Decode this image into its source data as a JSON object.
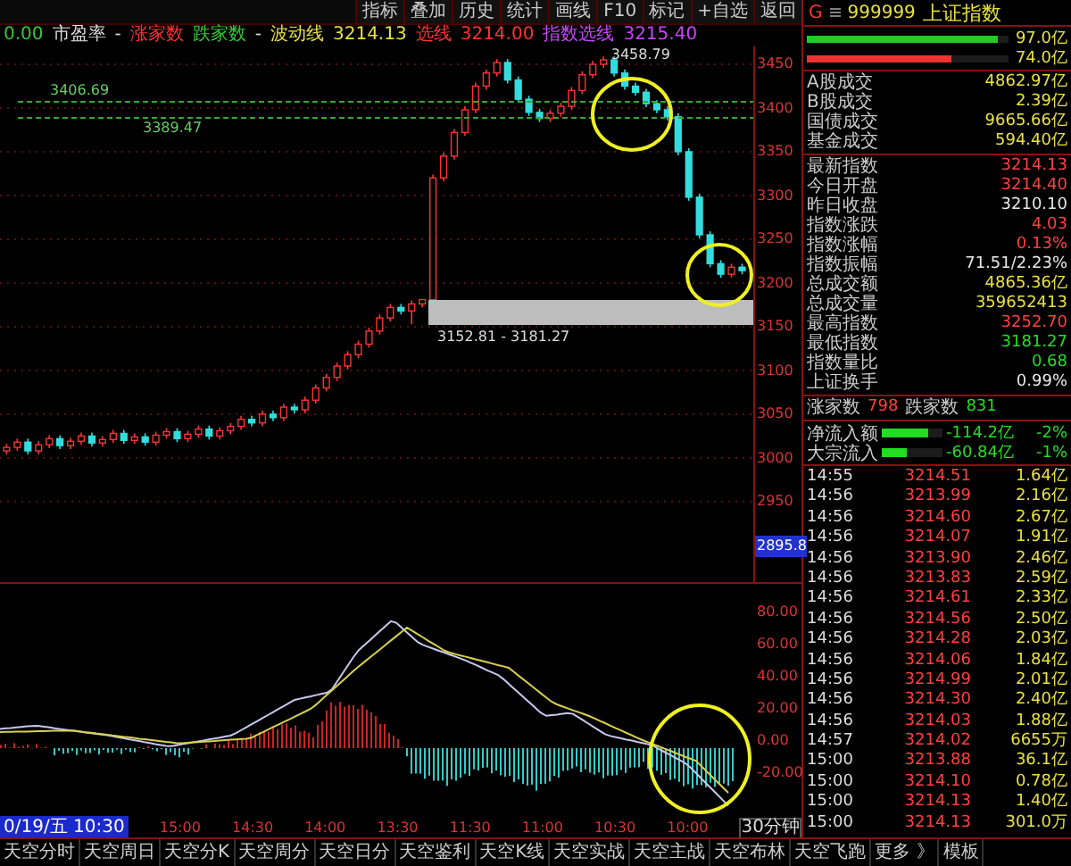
{
  "toolbar": {
    "buttons": [
      "指标",
      "叠加",
      "历史",
      "统计",
      "画线",
      "F10",
      "标记",
      "+自选",
      "返回"
    ]
  },
  "info_bar": [
    {
      "text": "0.00",
      "color": "#33cc33"
    },
    {
      "text": "市盈率",
      "color": "#dddddd"
    },
    {
      "text": "-",
      "color": "#dddddd"
    },
    {
      "text": "涨家数",
      "color": "#ff3333"
    },
    {
      "text": "跌家数",
      "color": "#33cc33"
    },
    {
      "text": "-",
      "color": "#dddddd"
    },
    {
      "text": "波动线",
      "color": "#e8e040"
    },
    {
      "text": "3214.13",
      "color": "#e8e040"
    },
    {
      "text": "选线",
      "color": "#ff3333"
    },
    {
      "text": "3214.00",
      "color": "#ff3333"
    },
    {
      "text": "指数选线",
      "color": "#cc44ff"
    },
    {
      "text": "3215.40",
      "color": "#cc44ff"
    }
  ],
  "price_chart": {
    "level_labels": [
      "3406.69",
      "3389.47"
    ],
    "range_label": "3152.81 - 3181.27",
    "current_label": "2895.8",
    "chart_data": {
      "type": "candlestick",
      "grid": true,
      "ylim": [
        2858,
        3470.4
      ],
      "yticks": [
        3450,
        3400,
        3350,
        3300,
        3250,
        3200,
        3150,
        3100,
        3050,
        3000,
        2950
      ],
      "annotations": [
        "3458.79"
      ],
      "ohlc": [
        [
          3008,
          3016,
          3004,
          3012
        ],
        [
          3012,
          3022,
          3008,
          3018
        ],
        [
          3018,
          3022,
          3004,
          3008
        ],
        [
          3008,
          3019,
          3004,
          3015
        ],
        [
          3015,
          3026,
          3011,
          3022
        ],
        [
          3022,
          3026,
          3010,
          3014
        ],
        [
          3014,
          3023,
          3010,
          3019
        ],
        [
          3019,
          3029,
          3015,
          3025
        ],
        [
          3025,
          3029,
          3013,
          3017
        ],
        [
          3017,
          3025,
          3013,
          3021
        ],
        [
          3021,
          3032,
          3017,
          3028
        ],
        [
          3028,
          3032,
          3016,
          3020
        ],
        [
          3020,
          3028,
          3016,
          3024
        ],
        [
          3024,
          3028,
          3014,
          3018
        ],
        [
          3018,
          3030,
          3014,
          3026
        ],
        [
          3026,
          3034,
          3022,
          3030
        ],
        [
          3030,
          3034,
          3018,
          3022
        ],
        [
          3022,
          3031,
          3018,
          3027
        ],
        [
          3027,
          3037,
          3023,
          3033
        ],
        [
          3033,
          3037,
          3021,
          3025
        ],
        [
          3025,
          3035,
          3021,
          3031
        ],
        [
          3031,
          3040,
          3027,
          3036
        ],
        [
          3036,
          3048,
          3032,
          3044
        ],
        [
          3044,
          3048,
          3036,
          3040
        ],
        [
          3040,
          3054,
          3036,
          3050
        ],
        [
          3050,
          3054,
          3042,
          3046
        ],
        [
          3046,
          3062,
          3042,
          3058
        ],
        [
          3058,
          3062,
          3051,
          3055
        ],
        [
          3055,
          3070,
          3051,
          3066
        ],
        [
          3066,
          3084,
          3062,
          3080
        ],
        [
          3080,
          3096,
          3076,
          3092
        ],
        [
          3092,
          3109,
          3088,
          3105
        ],
        [
          3105,
          3122,
          3101,
          3118
        ],
        [
          3118,
          3134,
          3114,
          3130
        ],
        [
          3130,
          3149,
          3126,
          3145
        ],
        [
          3145,
          3164,
          3141,
          3160
        ],
        [
          3160,
          3176,
          3156,
          3172
        ],
        [
          3172,
          3176,
          3164,
          3168
        ],
        [
          3168,
          3180,
          3152.81,
          3176
        ],
        [
          3176,
          3181.27,
          3172,
          3181
        ],
        [
          3181,
          3324,
          3177,
          3320
        ],
        [
          3320,
          3349,
          3316,
          3345
        ],
        [
          3345,
          3376,
          3341,
          3372
        ],
        [
          3372,
          3402,
          3368,
          3398
        ],
        [
          3398,
          3429,
          3394,
          3425
        ],
        [
          3425,
          3444,
          3421,
          3440
        ],
        [
          3440,
          3456,
          3436,
          3452
        ],
        [
          3452,
          3456,
          3428,
          3432
        ],
        [
          3432,
          3436,
          3406,
          3410
        ],
        [
          3410,
          3414,
          3391,
          3395
        ],
        [
          3395,
          3399,
          3384,
          3388
        ],
        [
          3388,
          3398,
          3384,
          3394
        ],
        [
          3394,
          3406,
          3390,
          3402
        ],
        [
          3402,
          3424,
          3398,
          3420
        ],
        [
          3420,
          3442,
          3416,
          3438
        ],
        [
          3438,
          3454,
          3434,
          3450
        ],
        [
          3450,
          3458.79,
          3446,
          3455
        ],
        [
          3455,
          3459,
          3436,
          3440
        ],
        [
          3440,
          3444,
          3421,
          3425
        ],
        [
          3425,
          3429,
          3414,
          3418
        ],
        [
          3418,
          3422,
          3401,
          3405
        ],
        [
          3405,
          3409,
          3394,
          3398
        ],
        [
          3398,
          3402,
          3386,
          3390
        ],
        [
          3390,
          3394,
          3346,
          3350
        ],
        [
          3350,
          3354,
          3294,
          3298
        ],
        [
          3298,
          3302,
          3251,
          3255
        ],
        [
          3255,
          3259,
          3218,
          3222
        ],
        [
          3222,
          3226,
          3206,
          3210
        ],
        [
          3210,
          3222,
          3206,
          3218
        ],
        [
          3218,
          3222,
          3210,
          3214
        ]
      ]
    }
  },
  "macd_chart": {
    "y_axis": [
      "80.00",
      "60.00",
      "40.00",
      "20.00",
      "0.00",
      "-20.00"
    ]
  },
  "time_axis": {
    "labels": [
      "0/19/五 10:30",
      "15:00",
      "14:30",
      "14:00",
      "13:30",
      "11:30",
      "11:00",
      "10:30",
      "10:00"
    ],
    "period": "30分钟"
  },
  "bottom_tabs": [
    {
      "label": "天空分时",
      "selected": false
    },
    {
      "label": "天空周日",
      "selected": false
    },
    {
      "label": "天空分K",
      "selected": false
    },
    {
      "label": "天空周分",
      "selected": false
    },
    {
      "label": "天空日分",
      "selected": false
    },
    {
      "label": "天空鉴利",
      "selected": false
    },
    {
      "label": "天空K线",
      "selected": false
    },
    {
      "label": "天空实战",
      "selected": false
    },
    {
      "label": "天空主战",
      "selected": false
    },
    {
      "label": "天空布林",
      "selected": false
    },
    {
      "label": "天空飞跑",
      "selected": false
    },
    {
      "label": "更多 》",
      "selected": false
    },
    {
      "label": "模板",
      "selected": false
    }
  ],
  "quote_panel": {
    "marker": "G",
    "code": "999999",
    "name": "上证指数",
    "volume_bars": [
      {
        "value": "97.0亿",
        "level": 0.95,
        "color": "#22cc22"
      },
      {
        "value": "74.0亿",
        "level": 0.72,
        "color": "#ee3333"
      }
    ],
    "turnover": [
      {
        "label": "A股成交",
        "value": "4862.97亿"
      },
      {
        "label": "B股成交",
        "value": "2.39亿"
      },
      {
        "label": "国债成交",
        "value": "9665.66亿"
      },
      {
        "label": "基金成交",
        "value": "594.40亿"
      }
    ],
    "stats": [
      {
        "label": "最新指数",
        "value": "3214.13",
        "kind": "up"
      },
      {
        "label": "今日开盘",
        "value": "3214.40",
        "kind": "up"
      },
      {
        "label": "昨日收盘",
        "value": "3210.10",
        "kind": "flat"
      },
      {
        "label": "指数涨跌",
        "value": "4.03",
        "kind": "up"
      },
      {
        "label": "指数涨幅",
        "value": "0.13%",
        "kind": "up"
      },
      {
        "label": "指数振幅",
        "value": "71.51/2.23%",
        "kind": "flat"
      },
      {
        "label": "总成交额",
        "value": "4865.36亿",
        "kind": "volume"
      },
      {
        "label": "总成交量",
        "value": "359652413",
        "kind": "volume"
      },
      {
        "label": "最高指数",
        "value": "3252.70",
        "kind": "up"
      },
      {
        "label": "最低指数",
        "value": "3181.27",
        "kind": "down"
      },
      {
        "label": "指数量比",
        "value": "0.68",
        "kind": "down"
      },
      {
        "label": "上证换手",
        "value": "0.99%",
        "kind": "flat"
      }
    ],
    "breadth": {
      "up_label": "涨家数",
      "up_value": "798",
      "down_label": "跌家数",
      "down_value": "831"
    },
    "flows": [
      {
        "label": "净流入额",
        "level": 0.75,
        "value": "-114.2亿",
        "pct": "-2%"
      },
      {
        "label": "大宗流入",
        "level": 0.4,
        "value": "-60.84亿",
        "pct": "-1%"
      }
    ],
    "ticks": [
      {
        "time": "14:55",
        "price": "3214.51",
        "volume": "1.64亿"
      },
      {
        "time": "14:56",
        "price": "3213.99",
        "volume": "2.16亿"
      },
      {
        "time": "14:56",
        "price": "3214.60",
        "volume": "2.67亿"
      },
      {
        "time": "14:56",
        "price": "3214.07",
        "volume": "1.91亿"
      },
      {
        "time": "14:56",
        "price": "3213.90",
        "volume": "2.46亿"
      },
      {
        "time": "14:56",
        "price": "3213.83",
        "volume": "2.59亿"
      },
      {
        "time": "14:56",
        "price": "3214.61",
        "volume": "2.33亿"
      },
      {
        "time": "14:56",
        "price": "3214.56",
        "volume": "2.50亿"
      },
      {
        "time": "14:56",
        "price": "3214.28",
        "volume": "2.03亿"
      },
      {
        "time": "14:56",
        "price": "3214.06",
        "volume": "1.84亿"
      },
      {
        "time": "14:56",
        "price": "3214.99",
        "volume": "2.01亿"
      },
      {
        "time": "14:56",
        "price": "3214.30",
        "volume": "2.40亿"
      },
      {
        "time": "14:56",
        "price": "3214.03",
        "volume": "1.88亿"
      },
      {
        "time": "14:57",
        "price": "3214.02",
        "volume": "6655万"
      },
      {
        "time": "15:00",
        "price": "3213.88",
        "volume": "36.1亿"
      },
      {
        "time": "15:00",
        "price": "3214.10",
        "volume": "0.78亿"
      },
      {
        "time": "15:00",
        "price": "3214.13",
        "volume": "1.40亿"
      },
      {
        "time": "15:00",
        "price": "3214.13",
        "volume": "301.0万"
      }
    ]
  }
}
